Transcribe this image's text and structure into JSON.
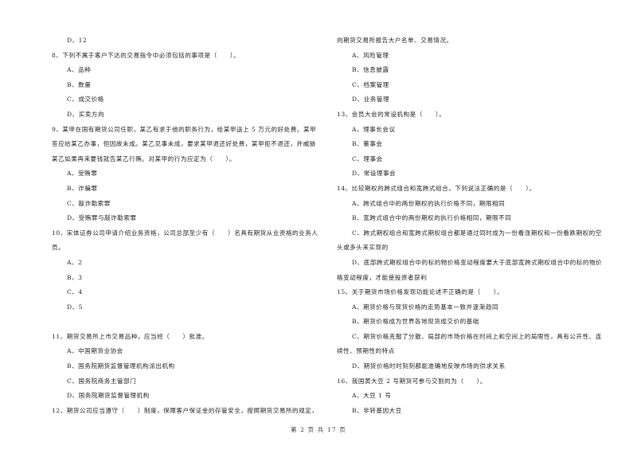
{
  "left_column": [
    {
      "type": "opt",
      "text": "D、12"
    },
    {
      "type": "q",
      "text": "8、下列不属于客户下达的交易指令中必须包括的事项是（　　）。"
    },
    {
      "type": "opt",
      "text": "A、品种"
    },
    {
      "type": "opt",
      "text": "B、数量"
    },
    {
      "type": "opt",
      "text": "C、成交价格"
    },
    {
      "type": "opt",
      "text": "D、买卖方向"
    },
    {
      "type": "q",
      "text": "9、某甲在国有期货公司任职，某乙有求于他的职务行为，给某甲送上 5 万元的好处费。某甲"
    },
    {
      "type": "q",
      "text": "答应给某乙办事，但因故未成。某乙见事未成，要求某甲退还好处费，某甲拒不退还，并威胁"
    },
    {
      "type": "q",
      "text": "某乙如果再来要钱就告某乙行贿。对某甲的行为应定为（　　）。"
    },
    {
      "type": "opt",
      "text": "A、受贿罪"
    },
    {
      "type": "opt",
      "text": "B、诈骗罪"
    },
    {
      "type": "opt",
      "text": "C、敲诈勒索罪"
    },
    {
      "type": "opt",
      "text": "D、受贿罪与敲诈勒索罪"
    },
    {
      "type": "q",
      "text": "10、宋体证券公司申请介绍业务资格，公司总部至少有（　　）名具有期货从业资格的业务人"
    },
    {
      "type": "q",
      "text": "员。"
    },
    {
      "type": "opt",
      "text": "A、2"
    },
    {
      "type": "opt",
      "text": "B、3"
    },
    {
      "type": "opt",
      "text": "C、4"
    },
    {
      "type": "opt",
      "text": "D、5"
    },
    {
      "type": "gap",
      "text": ""
    },
    {
      "type": "q",
      "text": "11、期货交易所上市交易品种，应当经（　　）批准。"
    },
    {
      "type": "opt",
      "text": "A、中国期货业协会"
    },
    {
      "type": "opt",
      "text": "B、国务院期货监督管理机构派出机构"
    },
    {
      "type": "opt",
      "text": "C、国务院商务主管部门"
    },
    {
      "type": "opt",
      "text": "D、国务院期货监督管理机构"
    },
    {
      "type": "q",
      "text": "12、期货公司应当遵守（　　）制度，保障客户保证金的存管安全，按照期货交易所的规定，"
    }
  ],
  "right_column": [
    {
      "type": "q",
      "text": "向期货交易所报告大户名单、交易情况。"
    },
    {
      "type": "opt",
      "text": "A、风险管理"
    },
    {
      "type": "opt",
      "text": "B、信息披露"
    },
    {
      "type": "opt",
      "text": "C、档案管理"
    },
    {
      "type": "opt",
      "text": "D、业务管理"
    },
    {
      "type": "q",
      "text": "13、会员大会的常设机构是（　　）。"
    },
    {
      "type": "opt",
      "text": "A、理事长会议"
    },
    {
      "type": "opt",
      "text": "B、董事会"
    },
    {
      "type": "opt",
      "text": "C、理事会"
    },
    {
      "type": "opt",
      "text": "D、常设理事会"
    },
    {
      "type": "q",
      "text": "14、比较期权的跨式组合和宽跨式组合，下列说法正确的是（　　）。"
    },
    {
      "type": "opt",
      "text": "A、跨式组合中的两份期权的执行价格不同，期限相同"
    },
    {
      "type": "opt",
      "text": "B、宽跨式组合中的两份期权的执行价格相同，期限不同"
    },
    {
      "type": "opt",
      "text": "C、跨式期权组合和宽跨式期权组合都是通过同时成为一份看涨期权和一份看跌期权的空"
    },
    {
      "type": "q",
      "text": "头或多头来实现的"
    },
    {
      "type": "opt",
      "text": "D、底部跨式期权组合中的标的物价格变动程度要大于底部宽跨式期权组合中的标的物价"
    },
    {
      "type": "q",
      "text": "格变动程度，才能使投资者获利"
    },
    {
      "type": "q",
      "text": "15、关于期货市场价格发现功能论述不正确的是（　　）。"
    },
    {
      "type": "opt",
      "text": "A、期货价格与现货价格的走势基本一致并逐渐趋同"
    },
    {
      "type": "opt",
      "text": "B、期货价格成为世界各地现货成交价的基础"
    },
    {
      "type": "opt",
      "text": "C、期货价格克服了分散、局部的市场价格在时间上和空间上的局限性，具有公开性、连"
    },
    {
      "type": "q",
      "text": "续性、预期性的特点"
    },
    {
      "type": "opt",
      "text": "D、期货价格时时刻刻都能准确地反映市场的供求关系"
    },
    {
      "type": "q",
      "text": "16、我国黄大豆 2 号期货可参与交割的为（　　）。"
    },
    {
      "type": "opt",
      "text": "A、大豆 1 号"
    },
    {
      "type": "opt",
      "text": "B、非转基因大豆"
    }
  ],
  "footer": {
    "page_label": "第 2 页 共 17 页"
  }
}
